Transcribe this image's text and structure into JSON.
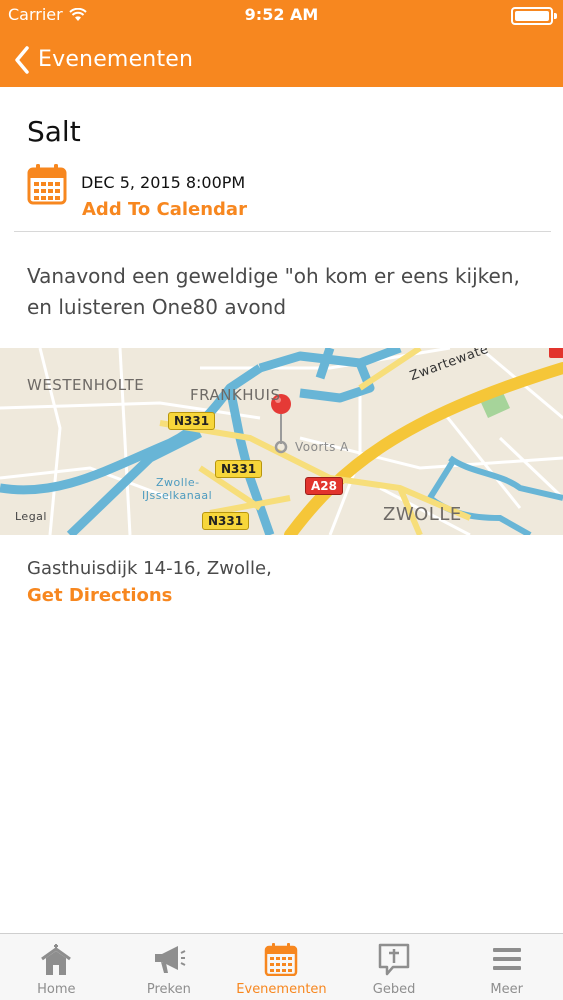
{
  "status_bar": {
    "carrier": "Carrier",
    "time": "9:52 AM"
  },
  "nav": {
    "back_label": "Evenementen"
  },
  "event": {
    "title": "Salt",
    "date": "DEC 5, 2015 8:00PM",
    "add_to_calendar": "Add To Calendar",
    "description": "Vanavond een geweldige \"oh kom er eens kijken, en luisteren One80 avond"
  },
  "map": {
    "labels": {
      "westenholte": "WESTENHOLTE",
      "frankhuis": "FRANKHUIS",
      "zwolle": "ZWOLLE",
      "zwartewate": "Zwartewate",
      "voorts": "Voorts A",
      "kanaal_1": "Zwolle-",
      "kanaal_2": "IJsselkanaal",
      "legal": "Legal"
    },
    "roads": {
      "n331_a": "N331",
      "n331_b": "N331",
      "n331_c": "N331",
      "a28": "A28"
    }
  },
  "location": {
    "address": "Gasthuisdijk 14-16, Zwolle,",
    "get_directions": "Get Directions"
  },
  "tabs": [
    {
      "label": "Home",
      "icon": "house-icon"
    },
    {
      "label": "Preken",
      "icon": "megaphone-icon"
    },
    {
      "label": "Evenementen",
      "icon": "calendar-icon"
    },
    {
      "label": "Gebed",
      "icon": "prayer-bubble-icon"
    },
    {
      "label": "Meer",
      "icon": "menu-icon"
    }
  ],
  "colors": {
    "accent": "#f7871f",
    "tab_inactive": "#8e8e8e",
    "map_background": "#efe9dc",
    "water": "#68b5d6",
    "highway": "#f5c638"
  }
}
